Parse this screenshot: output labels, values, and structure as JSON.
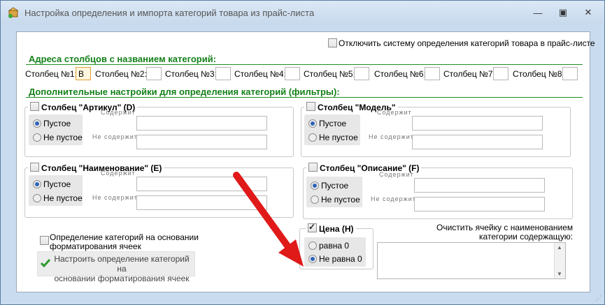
{
  "window": {
    "title": "Настройка определения и импорта категорий товара из прайс-листа",
    "controls": {
      "minimize": "—",
      "maximize": "▣",
      "close": "✕"
    }
  },
  "disable_checkbox": {
    "label": "Отключить систему определения категорий товара в прайс-листе",
    "checked": false
  },
  "columns_section": {
    "title": "Адреса столбцов с названием категорий:",
    "columns": [
      {
        "label": "Столбец №1:",
        "value": "B"
      },
      {
        "label": "Столбец №2:",
        "value": ""
      },
      {
        "label": "Столбец №3:",
        "value": ""
      },
      {
        "label": "Столбец №4:",
        "value": ""
      },
      {
        "label": "Столбец №5:",
        "value": ""
      },
      {
        "label": "Столбец №6:",
        "value": ""
      },
      {
        "label": "Столбец №7:",
        "value": ""
      },
      {
        "label": "Столбец №8:",
        "value": ""
      }
    ]
  },
  "filters_section": {
    "title": "Дополнительные настройки для определения категорий (фильтры):",
    "groups": [
      {
        "title": "Столбец \"Артикул\" (D)",
        "checked": false,
        "opt1": "Пустое",
        "opt2": "Не пустое",
        "selected": 1,
        "contains": "Содержит",
        "not_contains": "Не содержит"
      },
      {
        "title": "Столбец \"Модель\"",
        "checked": false,
        "opt1": "Пустое",
        "opt2": "Не пустое",
        "selected": 1,
        "contains": "Содержит",
        "not_contains": "Не содержит"
      },
      {
        "title": "Столбец \"Наименование\" (E)",
        "checked": false,
        "opt1": "Пустое",
        "opt2": "Не пустое",
        "selected": 1,
        "contains": "Содержит",
        "not_contains": "Не содержит"
      },
      {
        "title": "Столбец \"Описание\" (F)",
        "checked": false,
        "opt1": "Пустое",
        "opt2": "Не пустое",
        "selected": 1,
        "contains": "Содержит",
        "not_contains": "Не содержит"
      }
    ]
  },
  "format_checkbox": {
    "label_line1": "Определение категорий на основании",
    "label_line2": "форматирования ячеек",
    "checked": false
  },
  "format_button": {
    "line1": "Настроить определение категорий на",
    "line2": "основании форматирования ячеек"
  },
  "price_group": {
    "title": "Цена (H)",
    "checked": true,
    "opt1": "равна 0",
    "opt2": "Не равна 0",
    "selected": 2
  },
  "clear_cell": {
    "label_line1": "Очистить ячейку с наименованием",
    "label_line2": "категории содержащую:",
    "value": ""
  },
  "colors": {
    "section_green": "#138018",
    "annotation_arrow": "#e01919"
  }
}
